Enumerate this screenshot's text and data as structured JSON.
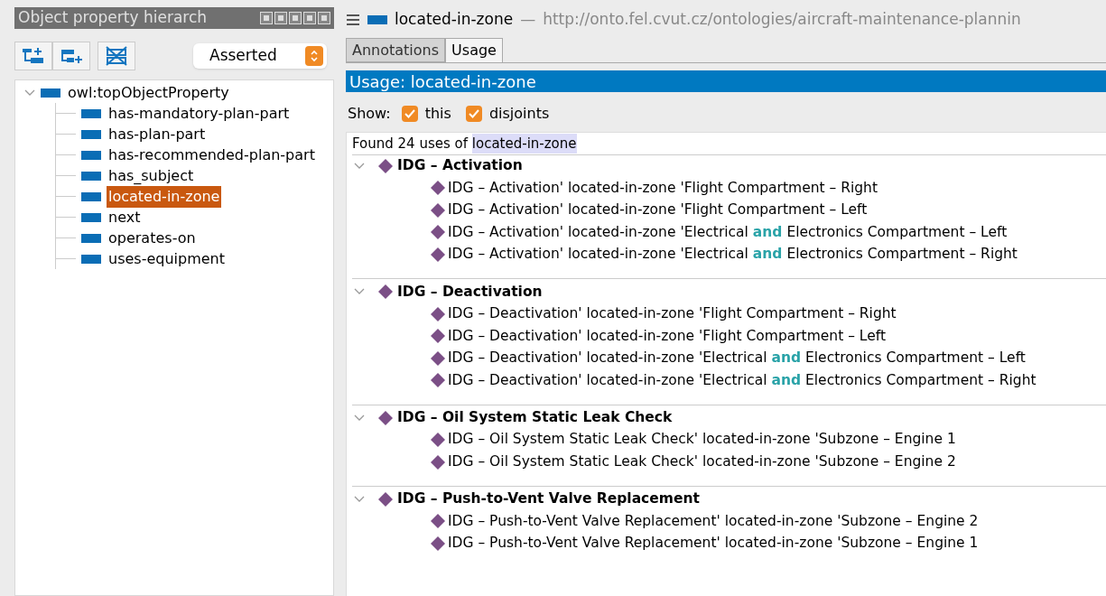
{
  "left_panel": {
    "title": "Object property hierarch",
    "toolbar_buttons": [
      {
        "kind": "add-child"
      },
      {
        "kind": "add-sibling"
      },
      {
        "kind": "delete"
      }
    ],
    "view_select": {
      "value": "Asserted"
    },
    "tree": [
      {
        "label": "owl:topObjectProperty",
        "expanded": true,
        "selected": false,
        "children": [
          {
            "label": "has-mandatory-plan-part",
            "selected": false
          },
          {
            "label": "has-plan-part",
            "selected": false
          },
          {
            "label": "has-recommended-plan-part",
            "selected": false
          },
          {
            "label": "has_subject",
            "selected": false
          },
          {
            "label": "located-in-zone",
            "selected": true
          },
          {
            "label": "next",
            "selected": false
          },
          {
            "label": "operates-on",
            "selected": false
          },
          {
            "label": "uses-equipment",
            "selected": false
          }
        ]
      }
    ]
  },
  "right_panel": {
    "entity": "located-in-zone",
    "separator": "—",
    "iri": "http://onto.fel.cvut.cz/ontologies/aircraft-maintenance-plannin",
    "tabs": [
      {
        "label": "Annotations",
        "selected": false
      },
      {
        "label": "Usage",
        "selected": true
      }
    ],
    "usage_title": "Usage: located-in-zone",
    "show": {
      "label": "Show:",
      "options": [
        {
          "label": "this",
          "checked": true
        },
        {
          "label": "disjoints",
          "checked": true
        }
      ]
    },
    "found": {
      "prefix": "Found 24 uses of",
      "term": "located-in-zone"
    },
    "groups": [
      {
        "title": "IDG – Activation",
        "expanded": true,
        "items": [
          [
            {
              "kind": "plain",
              "text": "IDG – Activation' located-in-zone 'Flight Compartment – Right"
            }
          ],
          [
            {
              "kind": "plain",
              "text": "IDG – Activation' located-in-zone 'Flight Compartment – Left"
            }
          ],
          [
            {
              "kind": "plain",
              "text": "IDG – Activation' located-in-zone 'Electrical"
            },
            {
              "kind": "keyword",
              "text": "and"
            },
            {
              "kind": "plain",
              "text": "Electronics Compartment – Left"
            }
          ],
          [
            {
              "kind": "plain",
              "text": "IDG – Activation' located-in-zone 'Electrical"
            },
            {
              "kind": "keyword",
              "text": "and"
            },
            {
              "kind": "plain",
              "text": "Electronics Compartment – Right"
            }
          ]
        ]
      },
      {
        "title": "IDG – Deactivation",
        "expanded": true,
        "items": [
          [
            {
              "kind": "plain",
              "text": "IDG – Deactivation' located-in-zone 'Flight Compartment – Right"
            }
          ],
          [
            {
              "kind": "plain",
              "text": "IDG – Deactivation' located-in-zone 'Flight Compartment – Left"
            }
          ],
          [
            {
              "kind": "plain",
              "text": "IDG – Deactivation' located-in-zone 'Electrical"
            },
            {
              "kind": "keyword",
              "text": "and"
            },
            {
              "kind": "plain",
              "text": "Electronics Compartment – Left"
            }
          ],
          [
            {
              "kind": "plain",
              "text": "IDG – Deactivation' located-in-zone 'Electrical"
            },
            {
              "kind": "keyword",
              "text": "and"
            },
            {
              "kind": "plain",
              "text": "Electronics Compartment – Right"
            }
          ]
        ]
      },
      {
        "title": "IDG – Oil System Static Leak Check",
        "expanded": true,
        "items": [
          [
            {
              "kind": "plain",
              "text": "IDG – Oil System Static Leak Check' located-in-zone 'Subzone – Engine 1"
            }
          ],
          [
            {
              "kind": "plain",
              "text": "IDG – Oil System Static Leak Check' located-in-zone 'Subzone – Engine 2"
            }
          ]
        ]
      },
      {
        "title": "IDG – Push-to-Vent Valve Replacement",
        "expanded": true,
        "items": [
          [
            {
              "kind": "plain",
              "text": "IDG – Push-to-Vent Valve Replacement' located-in-zone 'Subzone – Engine 2"
            }
          ],
          [
            {
              "kind": "plain",
              "text": "IDG – Push-to-Vent Valve Replacement' located-in-zone 'Subzone – Engine 1"
            }
          ]
        ]
      }
    ]
  }
}
